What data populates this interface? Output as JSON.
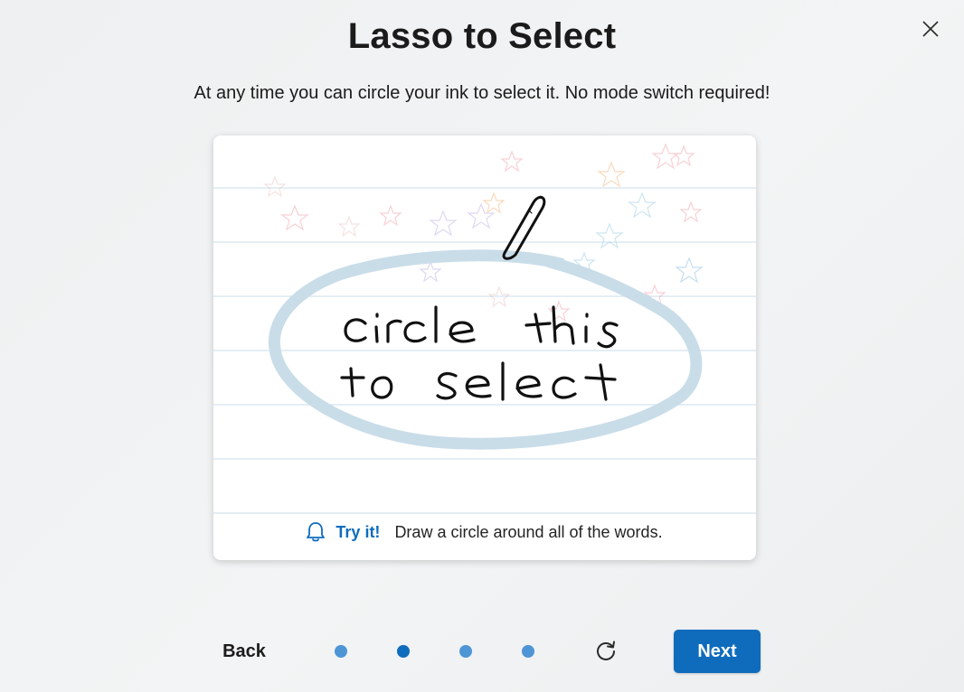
{
  "dialog": {
    "title": "Lasso to Select",
    "subtitle": "At any time you can circle your ink to select it. No mode switch required!",
    "close_icon": "close-icon"
  },
  "card": {
    "ink_line1": "circle this",
    "ink_line2": "to select",
    "hint_icon": "bell-icon",
    "try_it": "Try it!",
    "hint_text": "Draw a circle around all of the words.",
    "lasso_color": "#c9dde9"
  },
  "footer": {
    "back_label": "Back",
    "next_label": "Next",
    "pages_total": 4,
    "current_page": 2,
    "replay_icon": "replay-icon",
    "accent": "#0f6cbd",
    "dot_color": "#4e95d6"
  }
}
